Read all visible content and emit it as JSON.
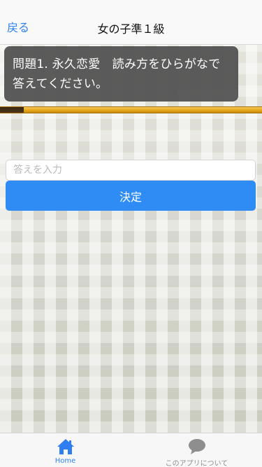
{
  "navbar": {
    "back_label": "戻る",
    "title": "女の子準１級"
  },
  "question": {
    "text": "問題1. 永久恋愛　読み方をひらがなで答えてください。"
  },
  "progress": {
    "fraction": 0.09
  },
  "answer": {
    "placeholder": "答えを入力",
    "value": ""
  },
  "submit": {
    "label": "決定"
  },
  "tabbar": {
    "home_label": "Home",
    "home_icon": "home-icon",
    "about_label": "このアプリについて",
    "about_icon": "speech-bubble-icon"
  },
  "colors": {
    "accent": "#2f8cf5",
    "question_bg": "#555555",
    "progress_gold": "#e7a91a",
    "progress_fill": "#3a2a14"
  }
}
